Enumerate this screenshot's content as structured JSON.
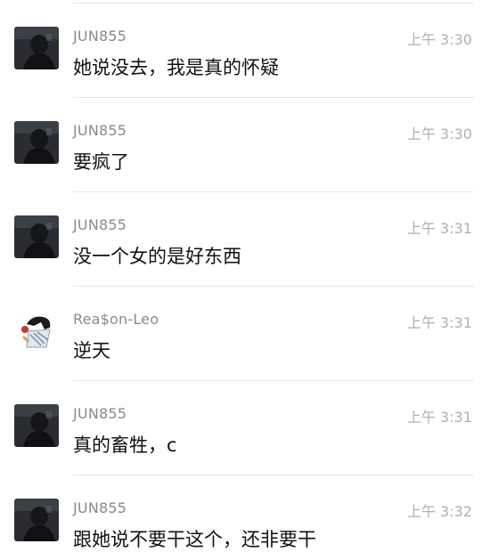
{
  "messages": [
    {
      "user": "JUN855",
      "time": "上午 3:30",
      "text": "她说没去，我是真的怀疑",
      "avatar": "dark-photo-avatar"
    },
    {
      "user": "JUN855",
      "time": "上午 3:30",
      "text": "要疯了",
      "avatar": "dark-photo-avatar"
    },
    {
      "user": "JUN855",
      "time": "上午 3:31",
      "text": "没一个女的是好东西",
      "avatar": "dark-photo-avatar"
    },
    {
      "user": "Rea$on-Leo",
      "time": "上午 3:31",
      "text": "逆天",
      "avatar": "cartoon-avatar"
    },
    {
      "user": "JUN855",
      "time": "上午 3:31",
      "text": "真的畜牲，c",
      "avatar": "dark-photo-avatar"
    },
    {
      "user": "JUN855",
      "time": "上午 3:32",
      "text": "跟她说不要干这个，还非要干",
      "avatar": "dark-photo-avatar"
    }
  ]
}
